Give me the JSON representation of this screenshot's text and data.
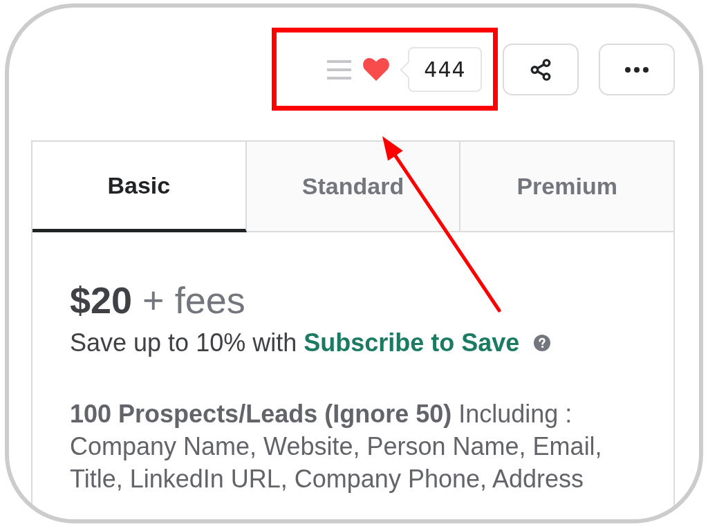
{
  "favorite": {
    "liked": true,
    "count": "444"
  },
  "tabs": [
    {
      "label": "Basic",
      "selected": true
    },
    {
      "label": "Standard",
      "selected": false
    },
    {
      "label": "Premium",
      "selected": false
    }
  ],
  "package": {
    "price": "**$20** + fees",
    "savings_note": "Save up to 10% with",
    "savings_link": "Subscribe to Save",
    "description": "**100 Prospects/Leads (Ignore 50)** Including : Company Name, Website, Person Name, Email, Title, LinkedIn URL, Company Phone, Address"
  }
}
